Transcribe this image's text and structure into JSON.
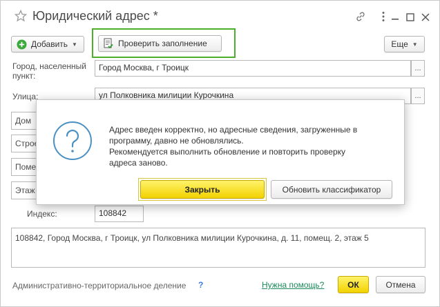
{
  "window": {
    "title": "Юридический адрес *",
    "icons": [
      "star-icon",
      "link-icon",
      "more-vertical-icon",
      "minimize-icon",
      "maximize-icon",
      "close-icon"
    ]
  },
  "toolbar": {
    "add_label": "Добавить",
    "check_label": "Проверить заполнение",
    "more_label": "Еще",
    "highlight_color": "#4caf2a"
  },
  "form": {
    "city_label": "Город, населенный пункт:",
    "city_value": "Город Москва, г Троицк",
    "street_label": "Улица:",
    "street_value": "ул Полковника милиции Курочкина",
    "house_label": "Дом",
    "building_label": "Строе",
    "room_label": "Поме",
    "floor_label": "Этаж",
    "index_label": "Индекс:",
    "index_value": "108842",
    "full_address": "108842, Город Москва, г Троицк, ул Полковника милиции Курочкина, д. 11, помещ. 2, этаж 5"
  },
  "footer": {
    "admin_division_label": "Административно-территориальное деление",
    "help_mark": "?",
    "help_link": "Нужна помощь?",
    "ok_label": "ОК",
    "cancel_label": "Отмена"
  },
  "dialog": {
    "icon": "question-icon",
    "message_lines": [
      "Адрес введен корректно, но адресные сведения, загруженные в",
      "программу, давно не обновлялись.",
      "Рекомендуется выполнить обновление и повторить проверку",
      "адреса заново."
    ],
    "close_label": "Закрыть",
    "update_label": "Обновить классификатор"
  },
  "colors": {
    "accent_yellow": "#f5d800",
    "link_green": "#1a8a5a",
    "question_icon_blue": "#4a90c2"
  }
}
